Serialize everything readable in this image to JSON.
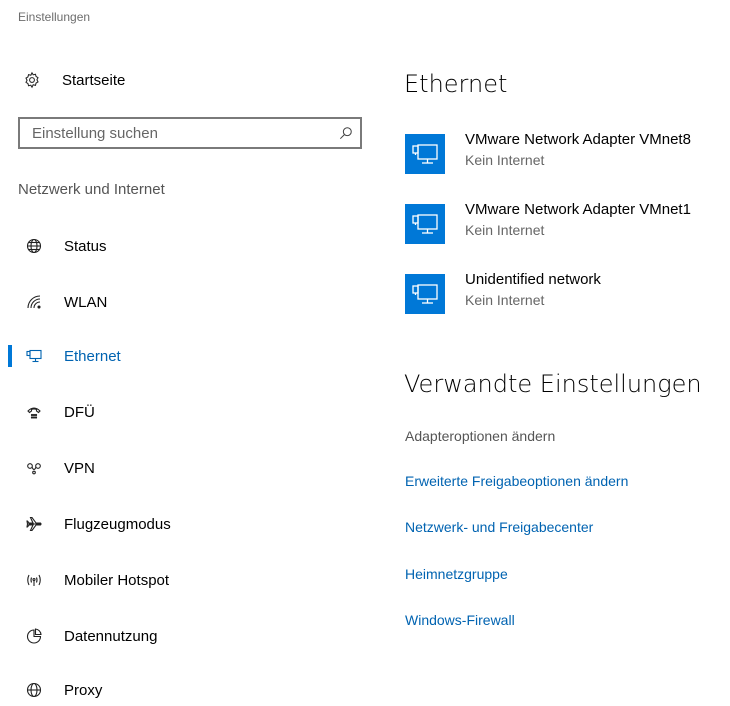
{
  "window": {
    "title": "Einstellungen"
  },
  "sidebar": {
    "home_label": "Startseite",
    "search": {
      "placeholder": "Einstellung suchen",
      "value": ""
    },
    "section_header": "Netzwerk und Internet",
    "items": [
      {
        "label": "Status",
        "icon": "globe-icon",
        "selected": false
      },
      {
        "label": "WLAN",
        "icon": "wifi-icon",
        "selected": false
      },
      {
        "label": "Ethernet",
        "icon": "ethernet-icon",
        "selected": true
      },
      {
        "label": "DFÜ",
        "icon": "dialup-icon",
        "selected": false
      },
      {
        "label": "VPN",
        "icon": "vpn-icon",
        "selected": false
      },
      {
        "label": "Flugzeugmodus",
        "icon": "airplane-icon",
        "selected": false
      },
      {
        "label": "Mobiler Hotspot",
        "icon": "hotspot-icon",
        "selected": false
      },
      {
        "label": "Datennutzung",
        "icon": "data-usage-icon",
        "selected": false
      },
      {
        "label": "Proxy",
        "icon": "proxy-globe-icon",
        "selected": false
      }
    ]
  },
  "main": {
    "title": "Ethernet",
    "adapters": [
      {
        "name": "VMware Network Adapter VMnet8",
        "status": "Kein Internet",
        "icon": "network-monitor-icon"
      },
      {
        "name": "VMware Network Adapter VMnet1",
        "status": "Kein Internet",
        "icon": "network-monitor-icon"
      },
      {
        "name": "Unidentified network",
        "status": "Kein Internet",
        "icon": "network-monitor-icon"
      }
    ],
    "related_title": "Verwandte Einstellungen",
    "related_links": [
      {
        "label": "Adapteroptionen ändern",
        "style": "plain"
      },
      {
        "label": "Erweiterte Freigabeoptionen ändern",
        "style": "link"
      },
      {
        "label": "Netzwerk- und Freigabecenter",
        "style": "link"
      },
      {
        "label": "Heimnetzgruppe",
        "style": "link"
      },
      {
        "label": "Windows-Firewall",
        "style": "link"
      }
    ]
  },
  "colors": {
    "accent": "#0078d7",
    "link": "#0063b1"
  }
}
